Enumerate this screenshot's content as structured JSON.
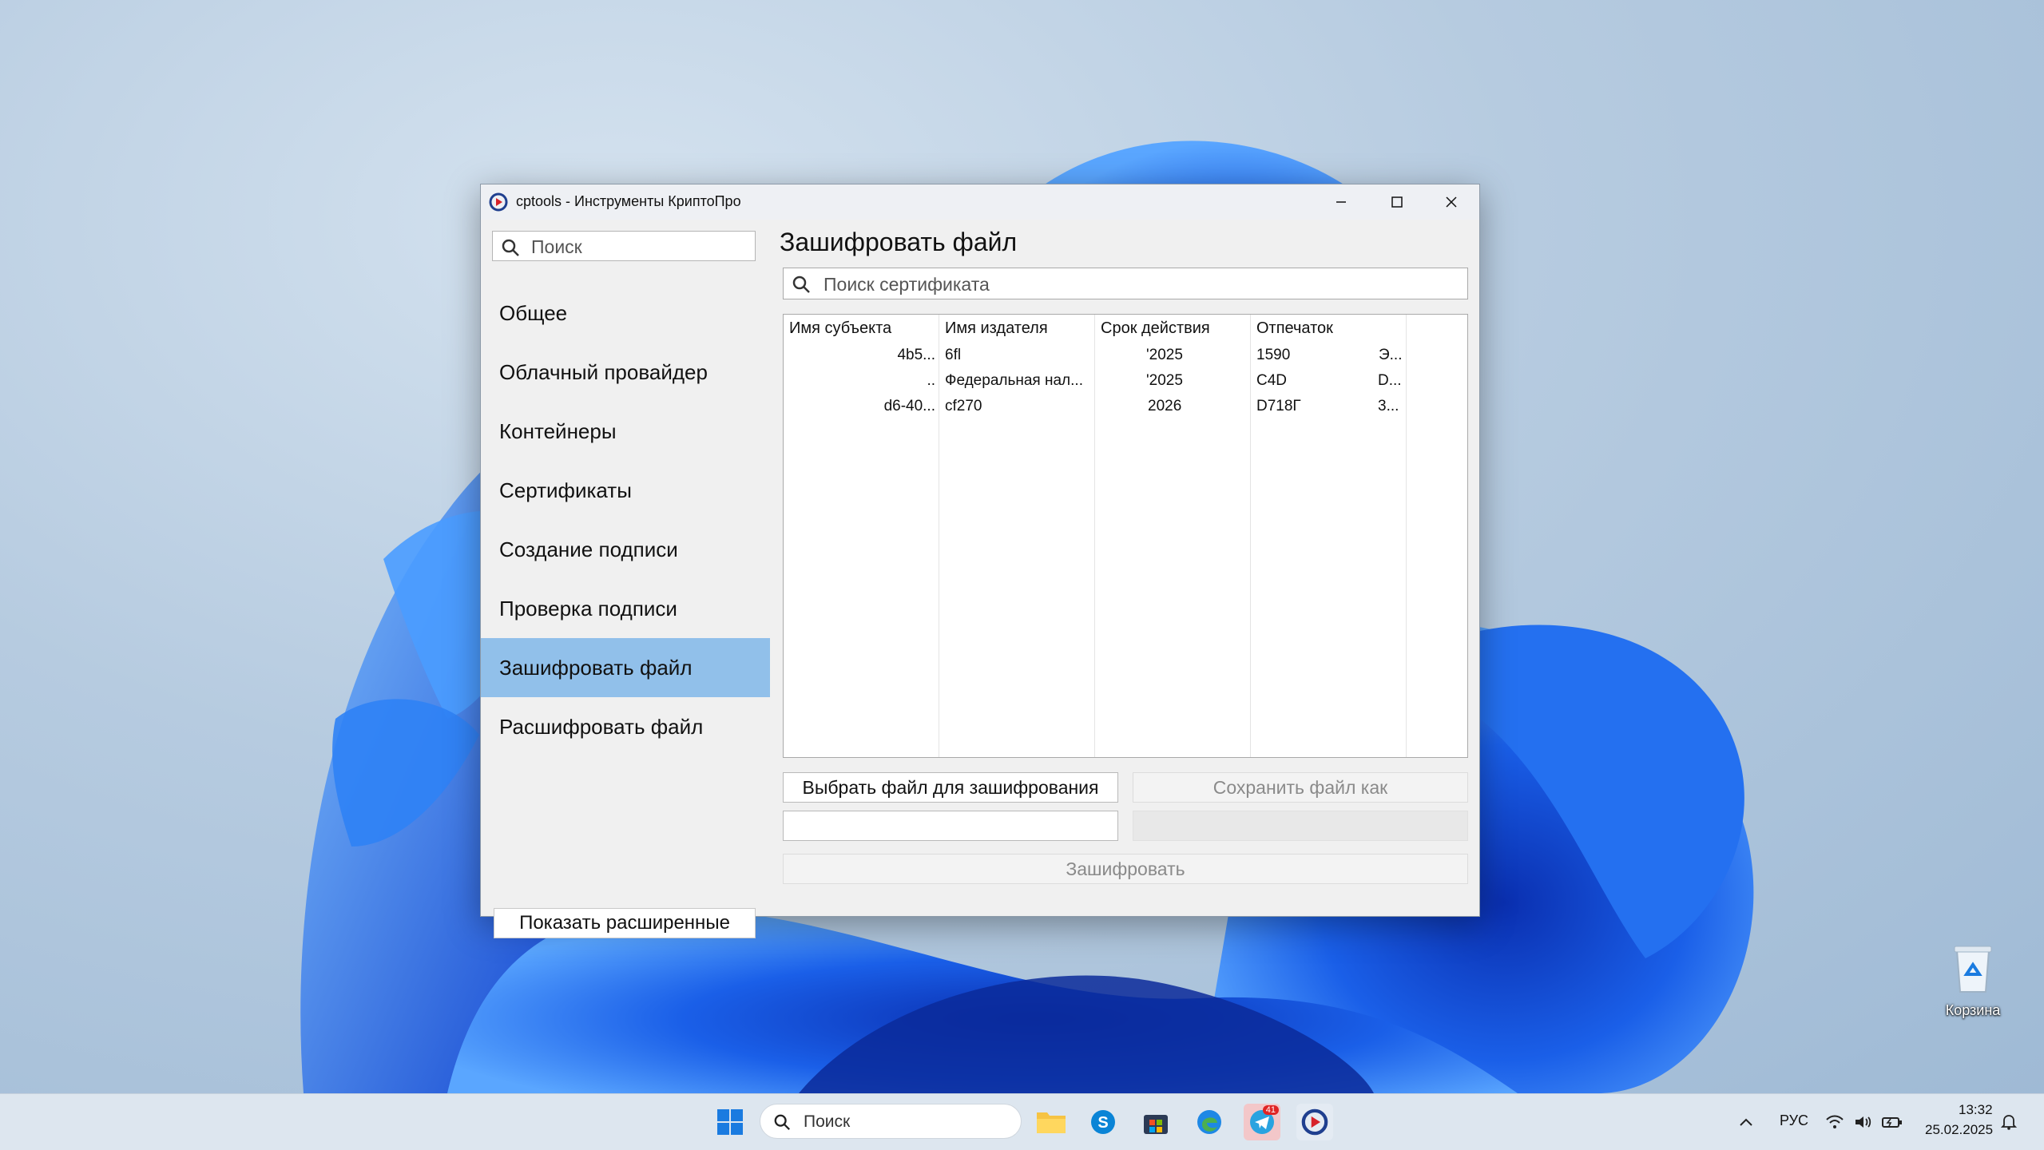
{
  "window": {
    "title": "cptools - Инструменты КриптоПро"
  },
  "sidebar": {
    "search_placeholder": "Поиск",
    "items": [
      {
        "label": "Общее"
      },
      {
        "label": "Облачный провайдер"
      },
      {
        "label": "Контейнеры"
      },
      {
        "label": "Сертификаты"
      },
      {
        "label": "Создание подписи"
      },
      {
        "label": "Проверка подписи"
      },
      {
        "label": "Зашифровать файл",
        "active": true
      },
      {
        "label": "Расшифровать файл"
      }
    ],
    "advanced_button": "Показать расширенные"
  },
  "main": {
    "title": "Зашифровать файл",
    "cert_search_placeholder": "Поиск сертификата",
    "table": {
      "headers": [
        "Имя субъекта",
        "Имя издателя",
        "Срок действия",
        "Отпечаток"
      ],
      "rows": [
        [
          "4b5...",
          "6fl",
          "'2025",
          "1590",
          "Э..."
        ],
        [
          "..",
          "Федеральная нал...",
          "'2025",
          "C4D",
          "D..."
        ],
        [
          "d6-40...",
          "cf270",
          "2026",
          "D718Г",
          "3..."
        ]
      ]
    },
    "choose_file_button": "Выбрать файл для зашифрования",
    "save_as_button": "Сохранить файл как",
    "encrypt_button": "Зашифровать"
  },
  "desktop": {
    "recycle_bin_label": "Корзина"
  },
  "taskbar": {
    "search_placeholder": "Поиск",
    "language": "РУС",
    "time": "13:32",
    "date": "25.02.2025",
    "telegram_badge": "41"
  },
  "colors": {
    "accent_selected": "#91c0ea",
    "wallpaper_blue": "#1565e8"
  }
}
